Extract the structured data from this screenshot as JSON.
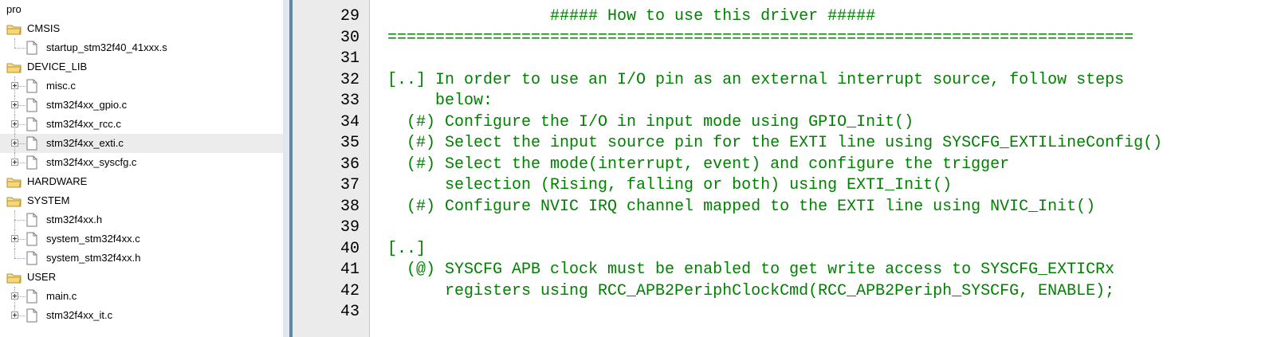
{
  "tree": {
    "root_label": "pro",
    "groups": [
      {
        "label": "CMSIS",
        "files": [
          {
            "label": "startup_stm32f40_41xxx.s",
            "expandable": false
          }
        ]
      },
      {
        "label": "DEVICE_LIB",
        "files": [
          {
            "label": "misc.c",
            "expandable": true
          },
          {
            "label": "stm32f4xx_gpio.c",
            "expandable": true
          },
          {
            "label": "stm32f4xx_rcc.c",
            "expandable": true
          },
          {
            "label": "stm32f4xx_exti.c",
            "expandable": true,
            "selected": true
          },
          {
            "label": "stm32f4xx_syscfg.c",
            "expandable": true
          }
        ]
      },
      {
        "label": "HARDWARE",
        "files": []
      },
      {
        "label": "SYSTEM",
        "files": [
          {
            "label": "stm32f4xx.h",
            "expandable": false
          },
          {
            "label": "system_stm32f4xx.c",
            "expandable": true
          },
          {
            "label": "system_stm32f4xx.h",
            "expandable": false
          }
        ]
      },
      {
        "label": "USER",
        "files": [
          {
            "label": "main.c",
            "expandable": true
          },
          {
            "label": "stm32f4xx_it.c",
            "expandable": true
          }
        ]
      }
    ]
  },
  "editor": {
    "lines": [
      {
        "num": "29",
        "text": "                 ##### How to use this driver #####"
      },
      {
        "num": "30",
        "text": "=============================================================================="
      },
      {
        "num": "31",
        "text": ""
      },
      {
        "num": "32",
        "text": "[..] In order to use an I/O pin as an external interrupt source, follow steps"
      },
      {
        "num": "33",
        "text": "     below:"
      },
      {
        "num": "34",
        "text": "  (#) Configure the I/O in input mode using GPIO_Init()"
      },
      {
        "num": "35",
        "text": "  (#) Select the input source pin for the EXTI line using SYSCFG_EXTILineConfig()"
      },
      {
        "num": "36",
        "text": "  (#) Select the mode(interrupt, event) and configure the trigger"
      },
      {
        "num": "37",
        "text": "      selection (Rising, falling or both) using EXTI_Init()"
      },
      {
        "num": "38",
        "text": "  (#) Configure NVIC IRQ channel mapped to the EXTI line using NVIC_Init()"
      },
      {
        "num": "39",
        "text": ""
      },
      {
        "num": "40",
        "text": "[..]"
      },
      {
        "num": "41",
        "text": "  (@) SYSCFG APB clock must be enabled to get write access to SYSCFG_EXTICRx"
      },
      {
        "num": "42",
        "text": "      registers using RCC_APB2PeriphClockCmd(RCC_APB2Periph_SYSCFG, ENABLE);"
      },
      {
        "num": "43",
        "text": ""
      }
    ]
  },
  "colors": {
    "comment_green": "#008000",
    "gutter_bg": "#ebebeb",
    "splitter_blue": "#5f86ad",
    "folder_yellow": "#f4d77a"
  }
}
